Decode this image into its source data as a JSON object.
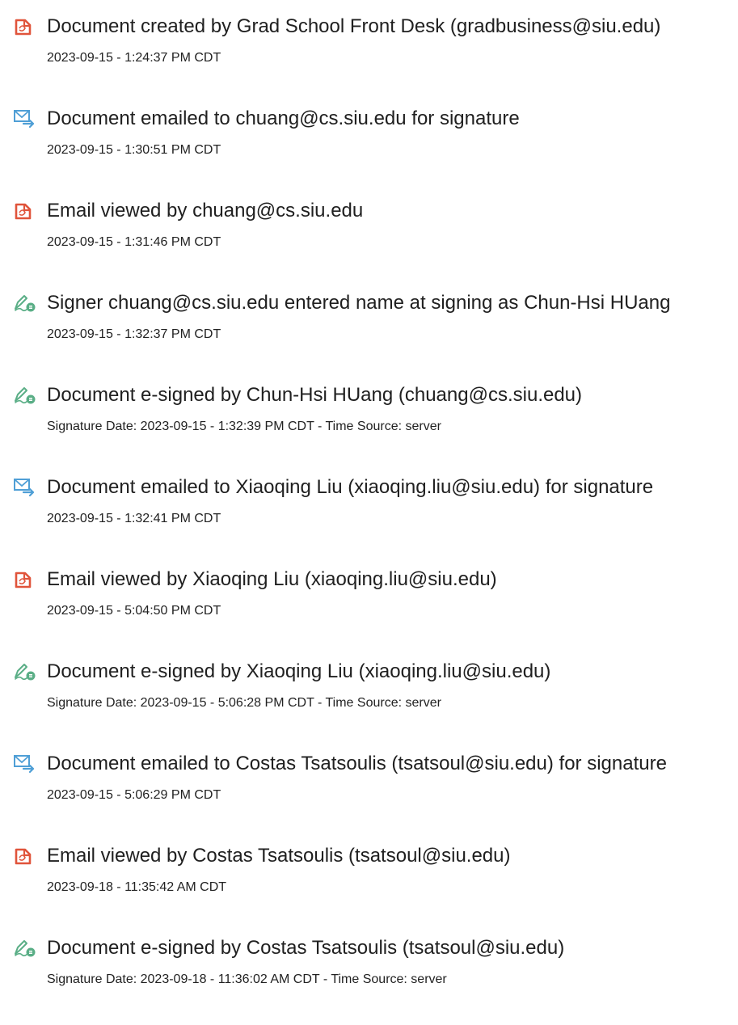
{
  "colors": {
    "document_icon": "#e0543b",
    "email_icon": "#4f9fd6",
    "signature_icon": "#5aae86"
  },
  "events": [
    {
      "icon": "document-icon",
      "title": "Document created by Grad School Front Desk (gradbusiness@siu.edu)",
      "detail": "2023-09-15 - 1:24:37 PM CDT"
    },
    {
      "icon": "email-icon",
      "title": "Document emailed to chuang@cs.siu.edu for signature",
      "detail": "2023-09-15 - 1:30:51 PM CDT"
    },
    {
      "icon": "document-icon",
      "title": "Email viewed by chuang@cs.siu.edu",
      "detail": "2023-09-15 - 1:31:46 PM CDT"
    },
    {
      "icon": "signature-icon",
      "title": "Signer chuang@cs.siu.edu entered name at signing as Chun-Hsi HUang",
      "detail": "2023-09-15 - 1:32:37 PM CDT"
    },
    {
      "icon": "signature-icon",
      "title": "Document e-signed by Chun-Hsi HUang (chuang@cs.siu.edu)",
      "detail": "Signature Date: 2023-09-15 - 1:32:39 PM CDT - Time Source: server"
    },
    {
      "icon": "email-icon",
      "title": "Document emailed to Xiaoqing Liu (xiaoqing.liu@siu.edu) for signature",
      "detail": "2023-09-15 - 1:32:41 PM CDT"
    },
    {
      "icon": "document-icon",
      "title": "Email viewed by Xiaoqing Liu (xiaoqing.liu@siu.edu)",
      "detail": "2023-09-15 - 5:04:50 PM CDT"
    },
    {
      "icon": "signature-icon",
      "title": "Document e-signed by Xiaoqing Liu (xiaoqing.liu@siu.edu)",
      "detail": "Signature Date: 2023-09-15 - 5:06:28 PM CDT - Time Source: server"
    },
    {
      "icon": "email-icon",
      "title": "Document emailed to Costas Tsatsoulis (tsatsoul@siu.edu) for signature",
      "detail": "2023-09-15 - 5:06:29 PM CDT"
    },
    {
      "icon": "document-icon",
      "title": "Email viewed by Costas Tsatsoulis (tsatsoul@siu.edu)",
      "detail": "2023-09-18 - 11:35:42 AM CDT"
    },
    {
      "icon": "signature-icon",
      "title": "Document e-signed by Costas Tsatsoulis (tsatsoul@siu.edu)",
      "detail": "Signature Date: 2023-09-18 - 11:36:02 AM CDT - Time Source: server"
    }
  ]
}
